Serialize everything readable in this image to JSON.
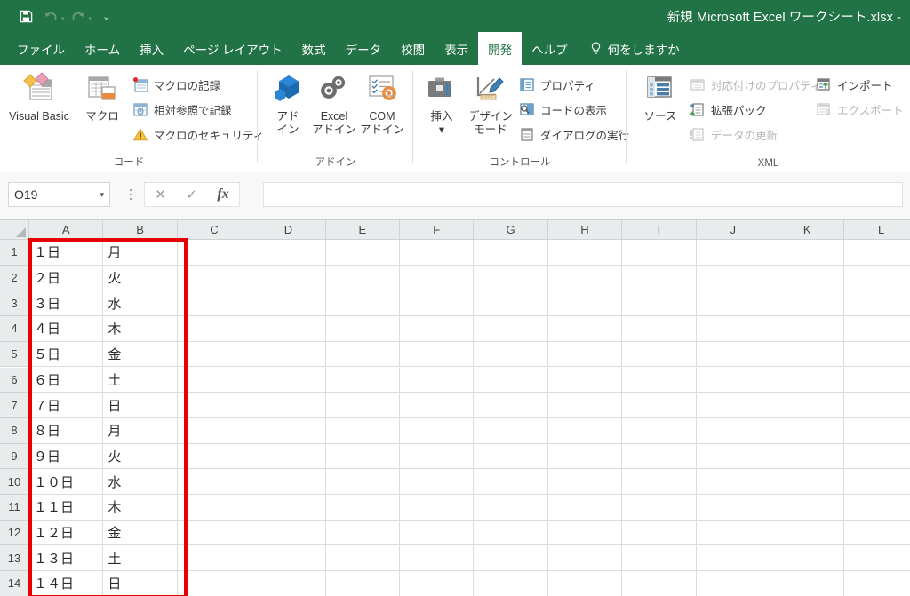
{
  "window": {
    "title": "新規 Microsoft Excel ワークシート.xlsx  -",
    "accent_green": "#217346",
    "selection_red": "#e60000"
  },
  "quick_access": {
    "items": [
      {
        "name": "save-icon",
        "label": "保存",
        "enabled": true
      },
      {
        "name": "undo-icon",
        "label": "元に戻す",
        "enabled": false
      },
      {
        "name": "redo-icon",
        "label": "やり直し",
        "enabled": false
      },
      {
        "name": "customize-quick-access-icon",
        "label": "クイック アクセス ツール バーのユーザー設定",
        "enabled": true
      }
    ]
  },
  "tabs": [
    {
      "label": "ファイル",
      "active": false
    },
    {
      "label": "ホーム",
      "active": false
    },
    {
      "label": "挿入",
      "active": false
    },
    {
      "label": "ページ レイアウト",
      "active": false
    },
    {
      "label": "数式",
      "active": false
    },
    {
      "label": "データ",
      "active": false
    },
    {
      "label": "校閲",
      "active": false
    },
    {
      "label": "表示",
      "active": false
    },
    {
      "label": "開発",
      "active": true
    },
    {
      "label": "ヘルプ",
      "active": false
    }
  ],
  "tell_me": {
    "label": "何をしますか",
    "icon": "lightbulb-icon"
  },
  "ribbon": {
    "groups": [
      {
        "id": "code",
        "label": "コード",
        "big_buttons": [
          {
            "label": "Visual Basic",
            "icon": "visual-basic-icon"
          },
          {
            "label": "マクロ",
            "icon": "macro-icon"
          }
        ],
        "small_buttons": [
          {
            "label": "マクロの記録",
            "icon": "record-macro-icon",
            "enabled": true
          },
          {
            "label": "相対参照で記録",
            "icon": "relative-reference-icon",
            "enabled": true
          },
          {
            "label": "マクロのセキュリティ",
            "icon": "macro-security-icon",
            "enabled": true
          }
        ]
      },
      {
        "id": "addins",
        "label": "アドイン",
        "big_buttons": [
          {
            "label": "アド\nイン",
            "icon": "addins-icon"
          },
          {
            "label": "Excel\nアドイン",
            "icon": "excel-addins-icon"
          },
          {
            "label": "COM\nアドイン",
            "icon": "com-addins-icon"
          }
        ],
        "small_buttons": []
      },
      {
        "id": "controls",
        "label": "コントロール",
        "big_buttons": [
          {
            "label": "挿入\n▾",
            "icon": "insert-control-icon"
          },
          {
            "label": "デザイン\nモード",
            "icon": "design-mode-icon"
          }
        ],
        "small_buttons": [
          {
            "label": "プロパティ",
            "icon": "properties-icon",
            "enabled": true
          },
          {
            "label": "コードの表示",
            "icon": "view-code-icon",
            "enabled": true
          },
          {
            "label": "ダイアログの実行",
            "icon": "run-dialog-icon",
            "enabled": true
          }
        ]
      },
      {
        "id": "xml",
        "label": "XML",
        "big_buttons": [
          {
            "label": "ソース",
            "icon": "xml-source-icon"
          }
        ],
        "small_buttons": [
          {
            "label": "対応付けのプロパティ",
            "icon": "map-properties-icon",
            "enabled": false
          },
          {
            "label": "拡張パック",
            "icon": "expansion-packs-icon",
            "enabled": true
          },
          {
            "label": "データの更新",
            "icon": "refresh-data-icon",
            "enabled": false
          },
          {
            "label": "インポート",
            "icon": "import-icon",
            "enabled": true
          },
          {
            "label": "エクスポート",
            "icon": "export-icon",
            "enabled": false
          }
        ]
      }
    ]
  },
  "formula_bar": {
    "name_box_value": "O19",
    "name_box_caret": "▾",
    "cancel_icon": "cancel-icon",
    "cancel_glyph": "✕",
    "enter_icon": "enter-icon",
    "enter_glyph": "✓",
    "function_icon": "insert-function-icon",
    "function_glyph": "fx",
    "formula_value": ""
  },
  "sheet": {
    "columns": [
      "A",
      "B",
      "C",
      "D",
      "E",
      "F",
      "G",
      "H",
      "I",
      "J",
      "K",
      "L"
    ],
    "rows": [
      "1",
      "2",
      "3",
      "4",
      "5",
      "6",
      "7",
      "8",
      "9",
      "10",
      "11",
      "12",
      "13",
      "14"
    ],
    "data": [
      [
        "１日",
        "月"
      ],
      [
        "２日",
        "火"
      ],
      [
        "３日",
        "水"
      ],
      [
        "４日",
        "木"
      ],
      [
        "５日",
        "金"
      ],
      [
        "６日",
        "土"
      ],
      [
        "７日",
        "日"
      ],
      [
        "８日",
        "月"
      ],
      [
        "９日",
        "火"
      ],
      [
        "１０日",
        "水"
      ],
      [
        "１１日",
        "木"
      ],
      [
        "１２日",
        "金"
      ],
      [
        "１３日",
        "土"
      ],
      [
        "１４日",
        "日"
      ]
    ],
    "highlight_range": "A1:B14"
  }
}
